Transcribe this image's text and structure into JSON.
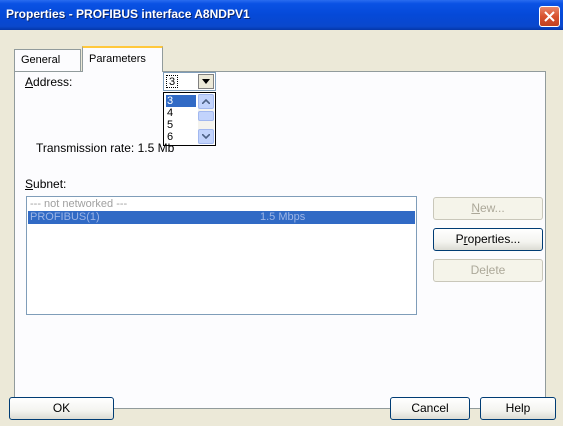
{
  "window": {
    "title": "Properties - PROFIBUS interface  A8NDPV1",
    "close_icon": "close-icon"
  },
  "tabs": [
    {
      "label": "General",
      "active": false
    },
    {
      "label": "Parameters",
      "active": true
    }
  ],
  "address": {
    "label_pre": "",
    "label_ul": "A",
    "label_post": "ddress:",
    "value": "3",
    "options": [
      "3",
      "4",
      "5",
      "6"
    ],
    "selected_option": "3"
  },
  "transmission_rate": "Transmission rate: 1.5 Mb",
  "subnet": {
    "label_ul": "S",
    "label_post": "ubnet:",
    "rows": [
      {
        "name": "--- not networked ---",
        "rate": ""
      },
      {
        "name": "PROFIBUS(1)",
        "rate": "1.5 Mbps",
        "selected": true
      }
    ]
  },
  "buttons": {
    "new": {
      "pre": "",
      "ul": "N",
      "post": "ew...",
      "enabled": false
    },
    "properties": {
      "pre": "P",
      "ul": "r",
      "post": "operties...",
      "enabled": true
    },
    "delete": {
      "pre": "De",
      "ul": "l",
      "post": "ete",
      "enabled": false
    },
    "ok": "OK",
    "cancel": "Cancel",
    "help": "Help"
  },
  "colors": {
    "titlebar": "#0549d8",
    "selection": "#316ac5",
    "dialog_bg": "#ece9d8"
  }
}
